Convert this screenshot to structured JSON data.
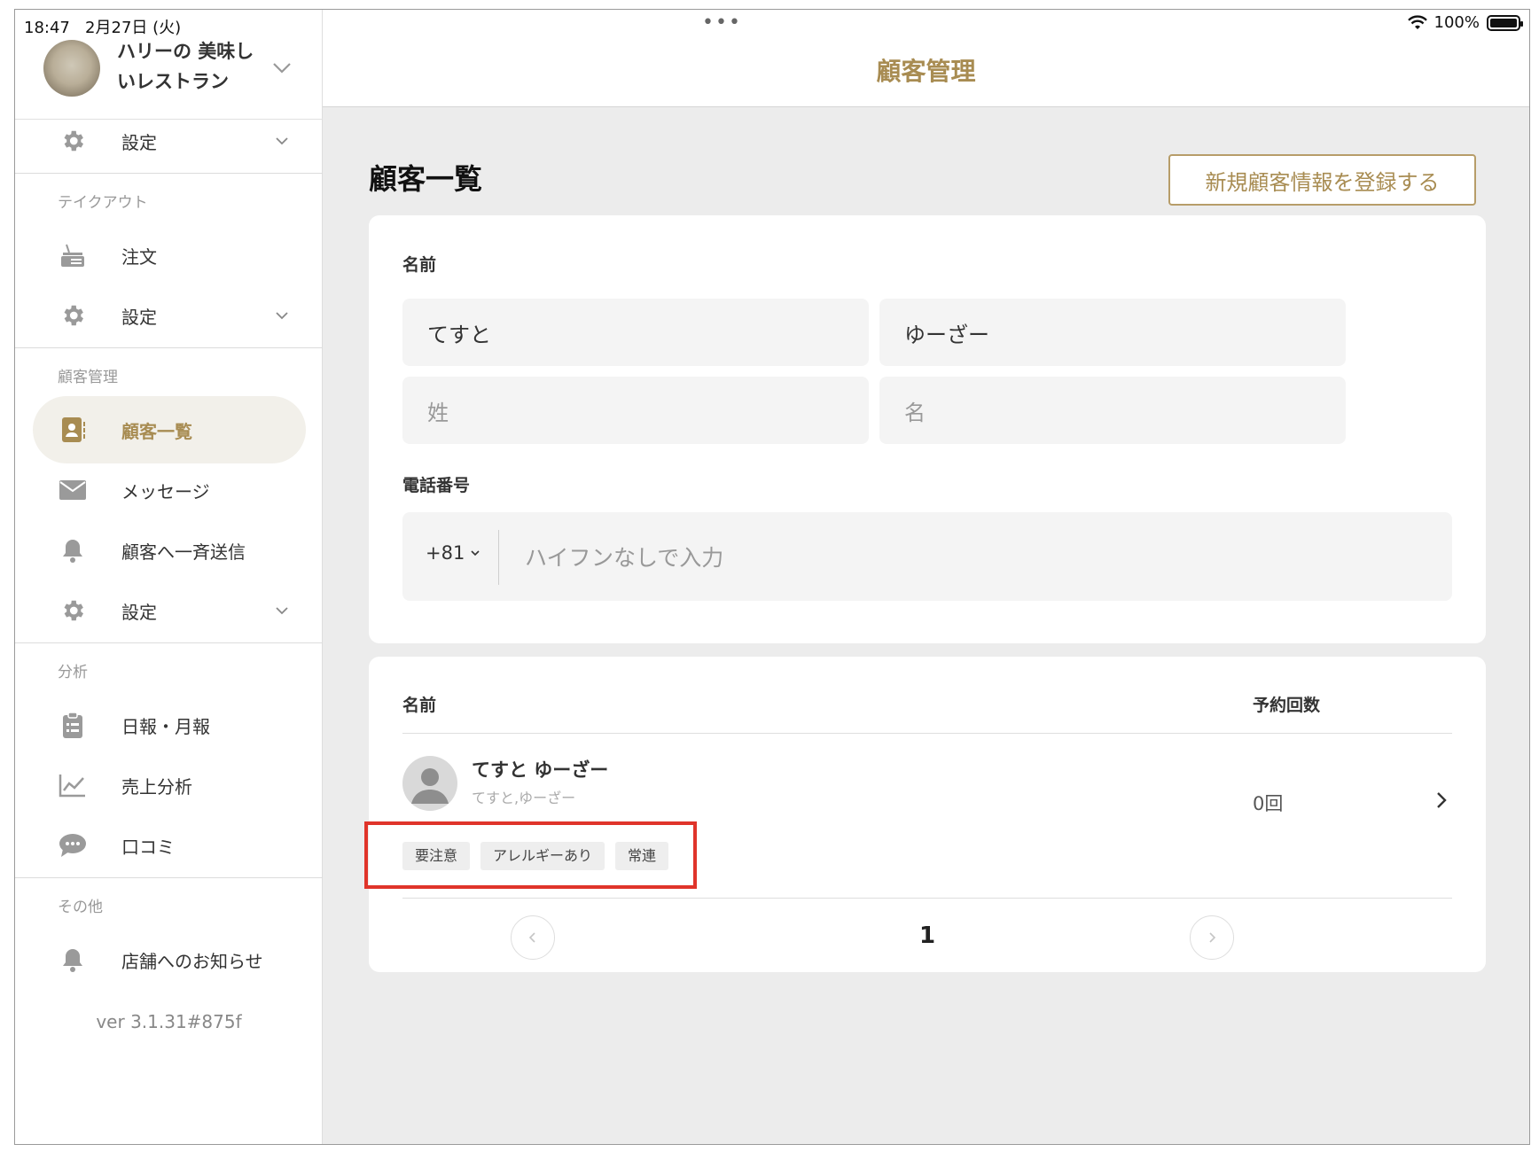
{
  "status_bar": {
    "time": "18:47",
    "date": "2月27日 (火)",
    "dots": "•••",
    "battery": "100%"
  },
  "store": {
    "name": "ハリーの 美味しいレストラン"
  },
  "sidebar": {
    "settings_top": "設定",
    "section_takeout": "テイクアウト",
    "takeout_order": "注文",
    "takeout_settings": "設定",
    "section_customers": "顧客管理",
    "customers_list": "顧客一覧",
    "customers_message": "メッセージ",
    "customers_broadcast": "顧客へ一斉送信",
    "customers_settings": "設定",
    "section_analysis": "分析",
    "analysis_reports": "日報・月報",
    "analysis_sales": "売上分析",
    "analysis_reviews": "口コミ",
    "section_other": "その他",
    "other_notices": "店舗へのお知らせ",
    "version": "ver 3.1.31#875f"
  },
  "header": {
    "title": "顧客管理"
  },
  "page": {
    "title": "顧客一覧",
    "register_button": "新規顧客情報を登録する"
  },
  "search": {
    "name_label": "名前",
    "last_name_kanji": "てすと",
    "first_name_kanji": "ゆーざー",
    "last_name_placeholder": "姓",
    "first_name_placeholder": "名",
    "phone_label": "電話番号",
    "country_code": "+81",
    "phone_placeholder": "ハイフンなしで入力"
  },
  "list": {
    "col_name": "名前",
    "col_reservations": "予約回数",
    "rows": [
      {
        "name": "てすと ゆーざー",
        "kana": "てすと,ゆーざー",
        "count": "0回",
        "tags": [
          "要注意",
          "アレルギーあり",
          "常連"
        ]
      }
    ],
    "page": "1"
  },
  "colors": {
    "accent": "#a88c52",
    "highlight": "#e0342a",
    "background": "#ececec"
  }
}
